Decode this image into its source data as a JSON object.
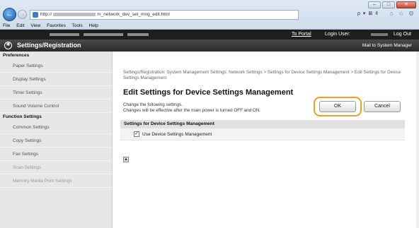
{
  "browser": {
    "address_prefix": "http://",
    "address_path": "m_network_dev_set_mng_edit.html",
    "addr_tools": "ρ ▾ ⊠ ¢",
    "menu": [
      "File",
      "Edit",
      "View",
      "Favorites",
      "Tools",
      "Help"
    ]
  },
  "header": {
    "to_portal": "To Portal",
    "login_user": "Login User:",
    "log_out": "Log Out",
    "section_title": "Settings/Registration",
    "mail": "Mail to System Manager"
  },
  "sidebar": {
    "preferences_heading": "Preferences",
    "preferences_items": [
      "Paper Settings",
      "Display Settings",
      "Timer Settings",
      "Sound Volume Control"
    ],
    "function_heading": "Function Settings",
    "function_items": [
      "Common Settings",
      "Copy Settings",
      "Fax Settings",
      "Scan Settings",
      "Memory Media Print Settings"
    ]
  },
  "main": {
    "breadcrumb": "Settings/Registration: System Management Settings: Network Settings > Settings for Device Settings Management > Edit Settings for Device Settings Management",
    "title": "Edit Settings for Device Settings Management",
    "desc_line1": "Change the following settings.",
    "desc_line2": "Changes will be effective after the main power is turned OFF and ON.",
    "ok_label": "OK",
    "cancel_label": "Cancel",
    "section_heading": "Settings for Device Settings Management",
    "checkbox_label": "Use Device Settings Management",
    "checkbox_checked": true
  }
}
